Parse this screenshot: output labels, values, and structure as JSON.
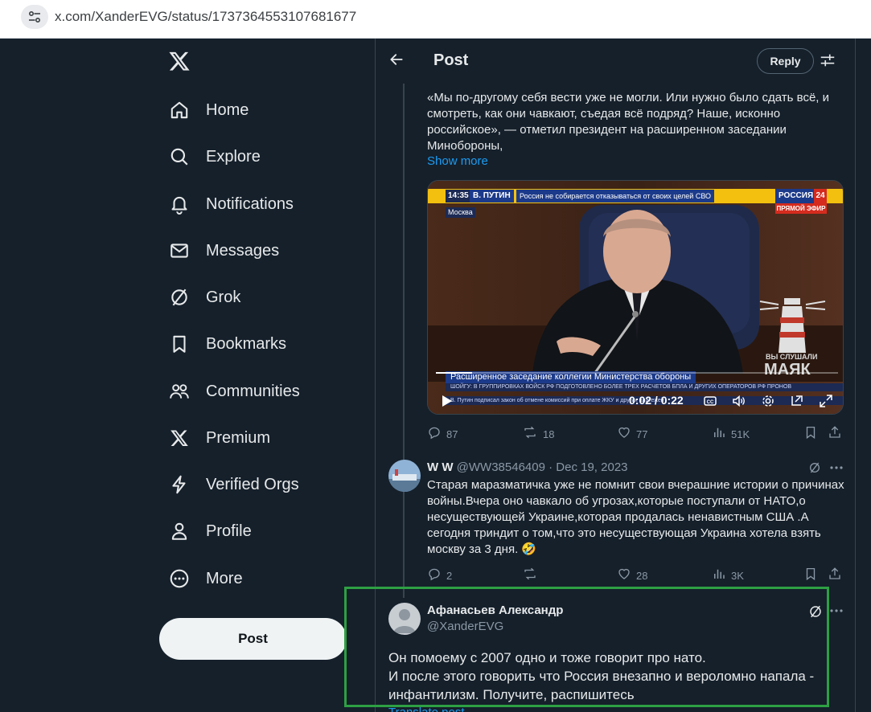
{
  "browser": {
    "url": "x.com/XanderEVG/status/1737364553107681677"
  },
  "sidebar": {
    "items": [
      {
        "label": "Home",
        "icon": "home-icon"
      },
      {
        "label": "Explore",
        "icon": "search-icon"
      },
      {
        "label": "Notifications",
        "icon": "bell-icon"
      },
      {
        "label": "Messages",
        "icon": "envelope-icon"
      },
      {
        "label": "Grok",
        "icon": "grok-icon"
      },
      {
        "label": "Bookmarks",
        "icon": "bookmark-icon"
      },
      {
        "label": "Communities",
        "icon": "people-icon"
      },
      {
        "label": "Premium",
        "icon": "x-logo-icon"
      },
      {
        "label": "Verified Orgs",
        "icon": "lightning-icon"
      },
      {
        "label": "Profile",
        "icon": "person-icon"
      },
      {
        "label": "More",
        "icon": "more-circle-icon"
      }
    ],
    "post_label": "Post"
  },
  "header": {
    "title": "Post",
    "reply_label": "Reply"
  },
  "main_tweet": {
    "text": "«Мы по-другому себя вести уже не могли. Или нужно было сдать всё, и смотреть, как они чавкают, съедая всё подряд? Наше, исконно российское», — отметил президент на расширенном заседании Минобороны,",
    "show_more": "Show more",
    "video": {
      "time_badge": "14:35",
      "speaker_badge": "В. ПУТИН",
      "headline": "Россия не собирается отказываться от своих целей СВО",
      "channel": "РОССИЯ",
      "channel_num": "24",
      "live": "ПРЯМОЙ ЭФИР",
      "city": "Москва",
      "lower_third": "Расширенное заседание коллегии Министерства обороны",
      "ticker_1": "ШОЙГУ: В ГРУППИРОВКАХ ВОЙСК РФ ПОДГОТОВЛЕНО БОЛЕЕ ТРЕХ РАСЧЕТОВ БПЛА И ДРУГИХ ОПЕРАТОРОВ РФ ПРОНОВ",
      "ticker_2": "В. Путин подписал закон об отмене комиссий при оплате ЖКУ и других платежей",
      "watermark_small": "ВЫ СЛУШАЛИ",
      "watermark_big": "МАЯК",
      "clock": "0:02 / 0:22",
      "progress": 0.09
    },
    "stats": {
      "replies": "87",
      "reposts": "18",
      "likes": "77",
      "views": "51K"
    }
  },
  "reply_1": {
    "name": "W W",
    "handle": "@WW38546409",
    "date": "· Dec 19, 2023",
    "text": "Старая маразматичка уже не помнит свои вчерашние истории о причинах войны.Вчера оно чавкало об угрозах,которые поступали от НАТО,о несуществующей Украине,которая продалась ненавистным  США .А сегодня  триндит о том,что это  несуществующая Украина хотела взять москву за 3 дня. 🤣",
    "stats": {
      "replies": "2",
      "likes": "28",
      "views": "3K"
    }
  },
  "focus_tweet": {
    "name": "Афанасьев Александр",
    "handle": "@XanderEVG",
    "text": "Он помоему с 2007 одно и тоже говорит про нато.\nИ после этого говорить что Россия внезапно и вероломно напала - инфантилизм. Получите, распишитесь",
    "translate": "Translate post"
  },
  "colors": {
    "background": "#15202b",
    "accent": "#1d9bf0",
    "highlight_box": "#2ea043"
  }
}
